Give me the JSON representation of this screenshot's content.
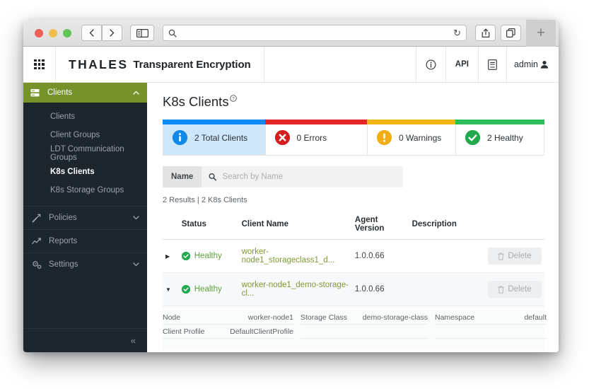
{
  "browser": {
    "traffic_lights": [
      "close",
      "minimize",
      "maximize"
    ],
    "back_label": "‹",
    "forward_label": "›",
    "sidebar_toggle": "sidebar-icon",
    "url_value": "",
    "url_placeholder": "",
    "reload_label": "↻",
    "share_label": "share-icon",
    "tabs_label": "tabs-icon",
    "newtab_label": "+"
  },
  "header": {
    "app_grid": "app-grid-icon",
    "brand": "THALES",
    "brand_sub": "Transparent Encryption",
    "info_label": "ⓘ",
    "api_label": "API",
    "docs_label": "docs-icon",
    "user_label": "admin"
  },
  "sidebar": {
    "header": {
      "label": "Clients",
      "icon": "server-icon",
      "chevron": "⌃"
    },
    "sub_items": [
      {
        "label": "Clients",
        "active": false
      },
      {
        "label": "Client Groups",
        "active": false
      },
      {
        "label": "LDT Communication Groups",
        "active": false
      },
      {
        "label": "K8s Clients",
        "active": true
      },
      {
        "label": "K8s Storage Groups",
        "active": false
      }
    ],
    "groups": [
      {
        "label": "Policies",
        "icon": "policy-icon",
        "chevron": "⌄"
      },
      {
        "label": "Reports",
        "icon": "chart-icon",
        "chevron": ""
      },
      {
        "label": "Settings",
        "icon": "gear-icon",
        "chevron": "⌄"
      }
    ],
    "collapse_label": "«"
  },
  "main": {
    "title": "K8s Clients",
    "title_help": "ⓘ",
    "cards": [
      {
        "key": "total",
        "label": "2 Total Clients",
        "icon": "i",
        "bar_color": "#0d8bff"
      },
      {
        "key": "errors",
        "label": "0 Errors",
        "icon": "✕",
        "bar_color": "#e52525"
      },
      {
        "key": "warnings",
        "label": "0 Warnings",
        "icon": "!",
        "bar_color": "#f3b513"
      },
      {
        "key": "healthy",
        "label": "2 Healthy",
        "icon": "✓",
        "bar_color": "#2dbd5c"
      }
    ],
    "search": {
      "filter_label": "Name",
      "icon": "search-icon",
      "value": "",
      "placeholder": "Search by Name"
    },
    "results_text": "2 Results | 2 K8s Clients",
    "table": {
      "columns": [
        "",
        "Status",
        "Client Name",
        "Agent Version",
        "Description",
        ""
      ],
      "rows": [
        {
          "expanded": false,
          "expand_glyph": "▶",
          "status": "Healthy",
          "client_name": "worker-node1_storageclass1_d...",
          "agent_version": "1.0.0.66",
          "description": "",
          "action": "Delete"
        },
        {
          "expanded": true,
          "expand_glyph": "▼",
          "status": "Healthy",
          "client_name": "worker-node1_demo-storage-cl...",
          "agent_version": "1.0.0.66",
          "description": "",
          "action": "Delete"
        }
      ]
    },
    "detail": {
      "line1": [
        {
          "key": "Node",
          "value": "worker-node1"
        },
        {
          "key": "Storage Class",
          "value": "demo-storage-class"
        },
        {
          "key": "Namespace",
          "value": "default"
        }
      ],
      "line2": [
        {
          "key": "Client Profile",
          "value": "DefaultClientProfile"
        }
      ]
    }
  },
  "colors": {
    "brand_green": "#76922b",
    "sidebar_bg": "#1d252d",
    "link_green": "#7d9a33",
    "status_green": "#5fa33c"
  }
}
